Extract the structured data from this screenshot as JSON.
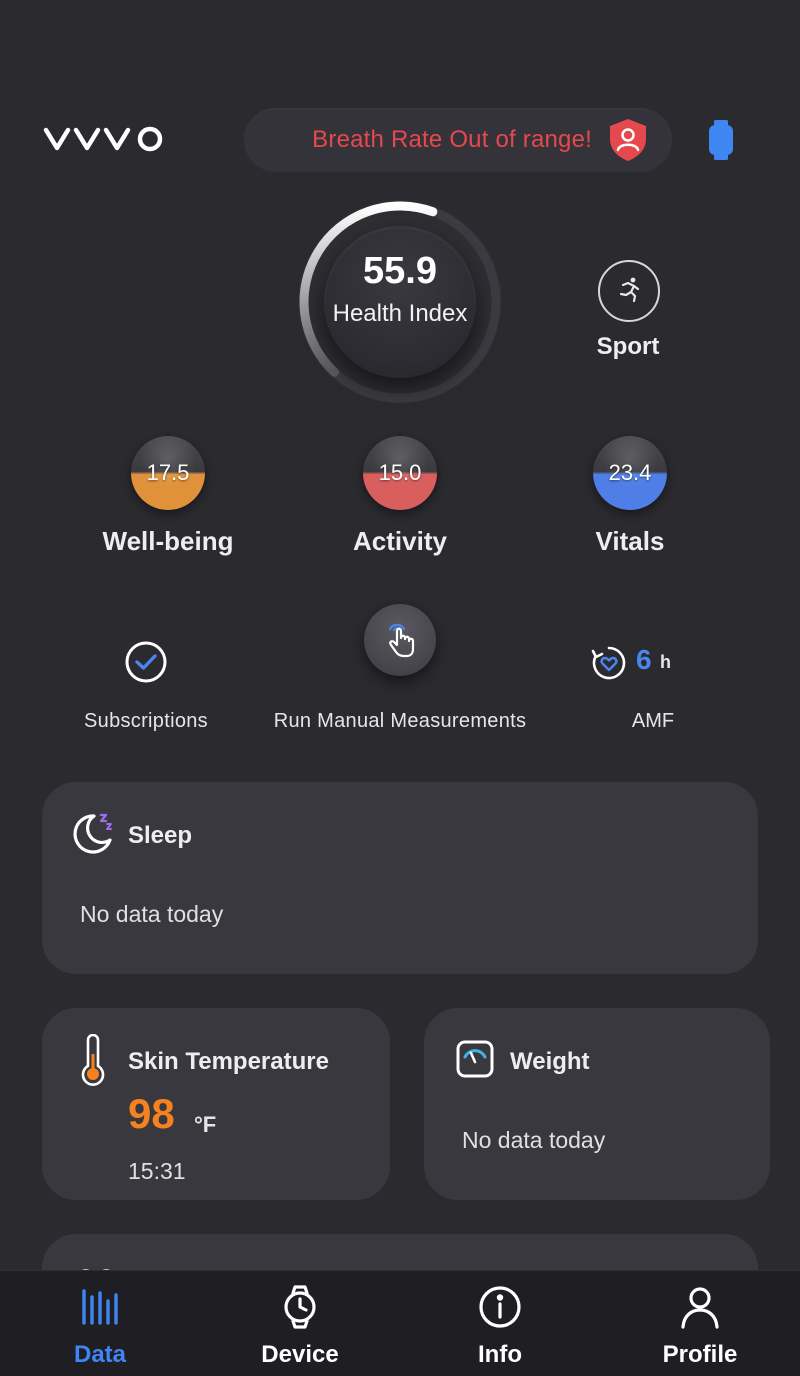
{
  "header": {
    "logo": "vyvo",
    "alert_text": "Breath Rate Out of range!",
    "alert_color": "#e5484d"
  },
  "health_index": {
    "value": "55.9",
    "label": "Health Index",
    "progress": 0.559
  },
  "sport": {
    "label": "Sport"
  },
  "scores": [
    {
      "value": "17.5",
      "label": "Well-being",
      "color": "#e0923a"
    },
    {
      "value": "15.0",
      "label": "Activity",
      "color": "#d95f5f"
    },
    {
      "value": "23.4",
      "label": "Vitals",
      "color": "#4f7fe6"
    }
  ],
  "actions": {
    "subscriptions": "Subscriptions",
    "run_manual": "Run Manual Measurements",
    "amf_value": "6",
    "amf_unit": "h",
    "amf_label": "AMF"
  },
  "cards": {
    "sleep": {
      "title": "Sleep",
      "status": "No data today"
    },
    "skin_temperature": {
      "title": "Skin Temperature",
      "value": "98",
      "unit": "°F",
      "time": "15:31",
      "value_color": "#f5821f"
    },
    "weight": {
      "title": "Weight",
      "status": "No data today"
    }
  },
  "nav": {
    "items": [
      {
        "label": "Data",
        "active": true
      },
      {
        "label": "Device"
      },
      {
        "label": "Info"
      },
      {
        "label": "Profile"
      }
    ],
    "active_color": "#3f86f2"
  }
}
